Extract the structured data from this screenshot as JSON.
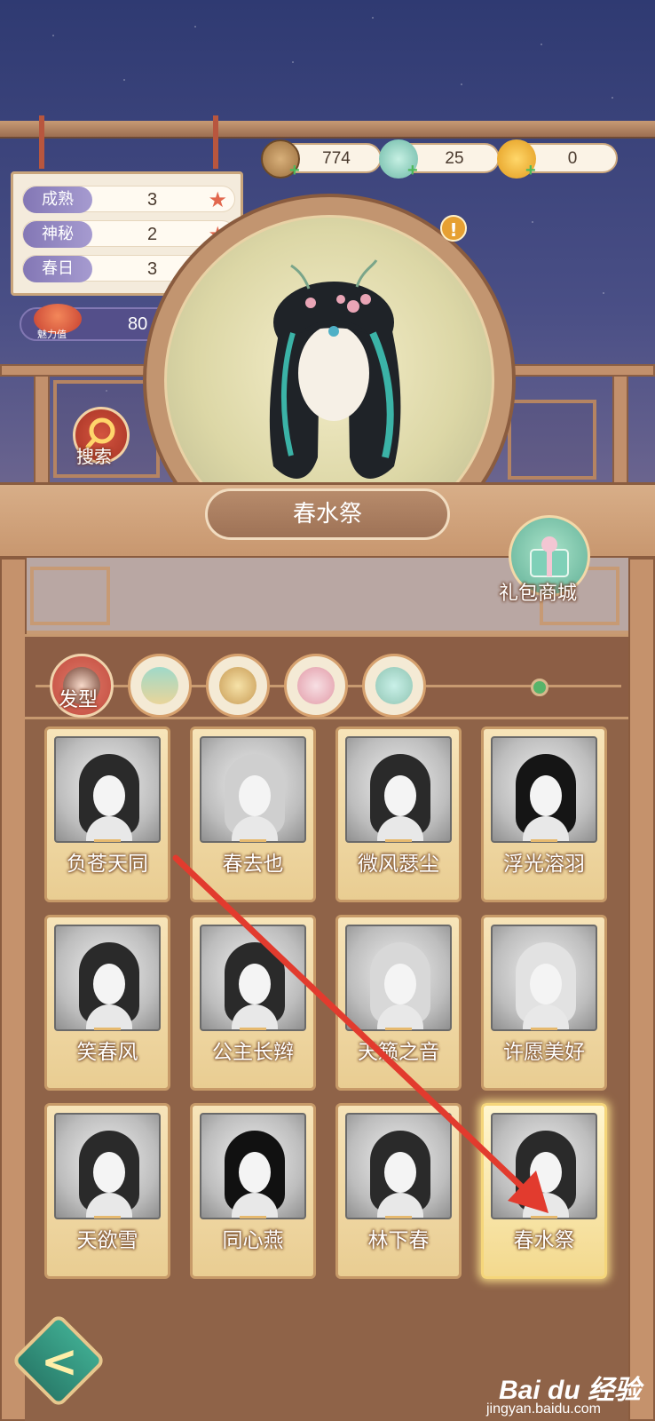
{
  "currencies": [
    {
      "name": "copper-coin",
      "value": "774",
      "color": "#b88a55"
    },
    {
      "name": "jade-dragon",
      "value": "25",
      "color": "#7cc6b6"
    },
    {
      "name": "gold-ingot",
      "value": "0",
      "color": "#f0b12e"
    }
  ],
  "attributes": [
    {
      "label": "成熟",
      "value": "3"
    },
    {
      "label": "神秘",
      "value": "2"
    },
    {
      "label": "春日",
      "value": "3"
    }
  ],
  "charm": {
    "label": "魅力值",
    "value": "80"
  },
  "search": {
    "label": "搜索"
  },
  "current_outfit": {
    "name": "春水祭"
  },
  "gift_shop": {
    "label": "礼包商城"
  },
  "tabs": [
    {
      "icon": "hairstyle-icon",
      "label": "发型",
      "active": true
    },
    {
      "icon": "dress-icon",
      "active": false
    },
    {
      "icon": "fan-icon",
      "active": false
    },
    {
      "icon": "accessory-icon",
      "active": false
    },
    {
      "icon": "mirror-icon",
      "active": false
    }
  ],
  "hairstyles": [
    {
      "name": "负苍天同"
    },
    {
      "name": "春去也"
    },
    {
      "name": "微风瑟尘"
    },
    {
      "name": "浮光溶羽"
    },
    {
      "name": "笑春风"
    },
    {
      "name": "公主长辫"
    },
    {
      "name": "天籁之音"
    },
    {
      "name": "许愿美好"
    },
    {
      "name": "天欲雪"
    },
    {
      "name": "同心燕"
    },
    {
      "name": "林下春"
    },
    {
      "name": "春水祭",
      "selected": true
    }
  ],
  "watermark": {
    "brand": "Bai du 经验",
    "url": "jingyan.baidu.com"
  },
  "colors": {
    "accent_red": "#e2674d",
    "wood": "#c79a74",
    "teal": "#3ea98f",
    "arrow": "#e23b2e"
  }
}
